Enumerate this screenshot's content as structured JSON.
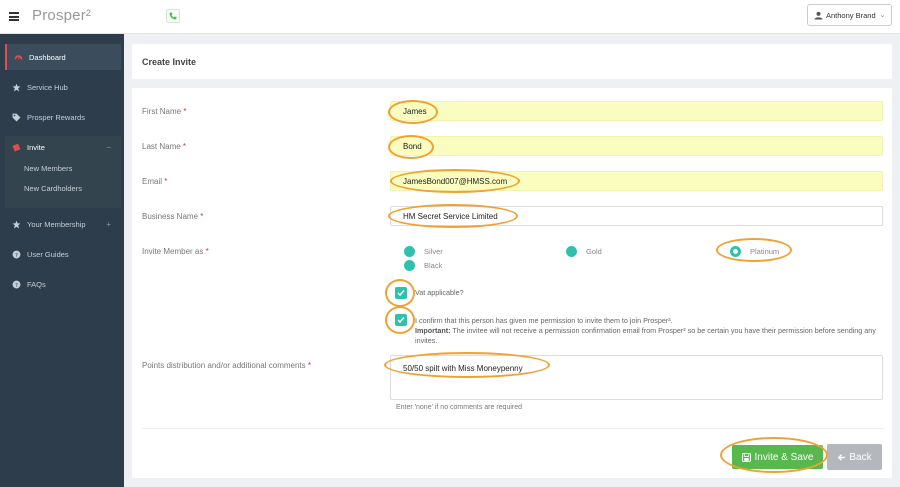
{
  "topbar": {
    "logo": "Prosper²",
    "user_name": "Anthony Brand"
  },
  "sidebar": {
    "items": [
      {
        "label": "Dashboard",
        "icon": "dashboard-icon"
      },
      {
        "label": "Service Hub",
        "icon": "star-icon"
      },
      {
        "label": "Prosper Rewards",
        "icon": "tag-icon"
      },
      {
        "label": "Invite",
        "icon": "ticket-icon"
      },
      {
        "label": "Your Membership",
        "icon": "star-icon"
      },
      {
        "label": "User Guides",
        "icon": "question-icon"
      },
      {
        "label": "FAQs",
        "icon": "question-icon"
      }
    ],
    "invite_sub": [
      "New Members",
      "New Cardholders"
    ],
    "invite_toggle": "−",
    "membership_toggle": "+"
  },
  "page": {
    "title": "Create Invite"
  },
  "form": {
    "first_name_label": "First Name",
    "first_name_value": "James",
    "last_name_label": "Last Name",
    "last_name_value": "Bond",
    "email_label": "Email",
    "email_value": "JamesBond007@HMSS.com",
    "business_label": "Business Name",
    "business_value": "HM Secret Service Limited",
    "invite_as_label": "Invite Member as",
    "options": [
      "Silver",
      "Gold",
      "Platinum",
      "Black"
    ],
    "selected_option": "Platinum",
    "vat_label": "Vat applicable?",
    "confirm_text": "I confirm that this person has given me permission to invite them to join Prosper².",
    "important_label": "Important:",
    "important_text": "The invitee will not receive a permission confirmation email from Prosper² so be certain you have their permission before sending any invites.",
    "comments_label": "Points distribution and/or additional comments",
    "comments_value": "50/50 spilt with Miss Moneypenny",
    "comments_hint": "Enter 'none' if no comments are required",
    "required_mark": "*"
  },
  "buttons": {
    "save": "Invite & Save",
    "back": "Back"
  },
  "colors": {
    "accent_teal": "#2ec2ad",
    "highlight_orange": "#f1a133",
    "save_green": "#57b84d",
    "sidebar_bg": "#2e3d4b",
    "autofill_yellow": "#fafdbf"
  }
}
